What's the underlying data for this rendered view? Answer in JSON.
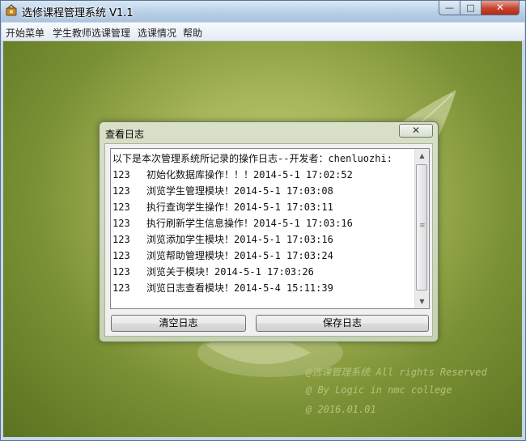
{
  "window": {
    "title": "选修课程管理系统 V1.1",
    "controls": {
      "minimize": "—",
      "maximize": "□",
      "close": "✕"
    }
  },
  "menu": {
    "items": [
      {
        "label": "开始菜单"
      },
      {
        "label": "学生教师选课管理"
      },
      {
        "label": "选课情况"
      },
      {
        "label": "帮助"
      }
    ]
  },
  "background": {
    "copyright": "@选课管理系统 All rights Reserved",
    "author": "@ By Logic in nmc college",
    "date": "@ 2016.01.01"
  },
  "dialog": {
    "title": "查看日志",
    "close": "✕",
    "log": {
      "header": "以下是本次管理系统所记录的操作日志--开发者：chenluozhi:",
      "entries": [
        {
          "id": "123",
          "text": "初始化数据库操作！！！2014-5-1 17:02:52"
        },
        {
          "id": "123",
          "text": "浏览学生管理模块！2014-5-1 17:03:08"
        },
        {
          "id": "123",
          "text": "执行查询学生操作！2014-5-1 17:03:11"
        },
        {
          "id": "123",
          "text": "执行刷新学生信息操作！2014-5-1 17:03:16"
        },
        {
          "id": "123",
          "text": "浏览添加学生模块！2014-5-1 17:03:16"
        },
        {
          "id": "123",
          "text": "浏览帮助管理模块！2014-5-1 17:03:24"
        },
        {
          "id": "123",
          "text": "浏览关于模块！2014-5-1 17:03:26"
        },
        {
          "id": "123",
          "text": "浏览日志查看模块！2014-5-4 15:11:39"
        }
      ]
    },
    "buttons": {
      "clear": "清空日志",
      "save": "保存日志"
    }
  },
  "colors": {
    "title_bar": "#b9cfe6",
    "background_green": "#7b9135",
    "close_red": "#c7442c"
  }
}
